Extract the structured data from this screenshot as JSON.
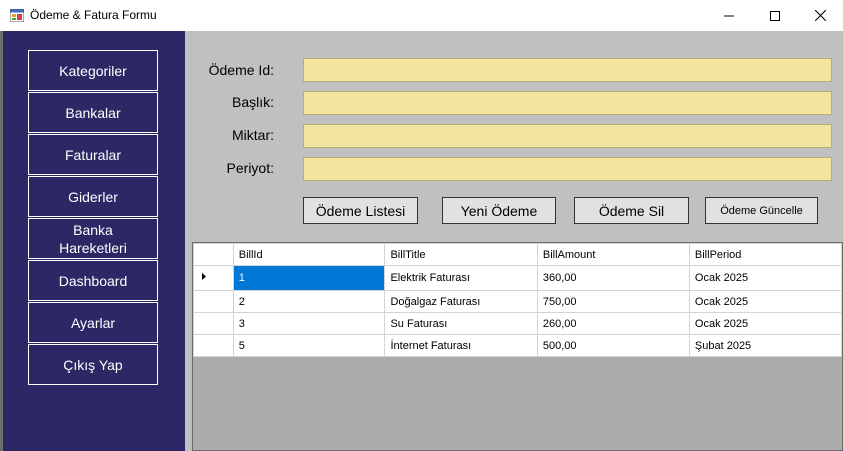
{
  "window": {
    "title": "Ödeme & Fatura Formu"
  },
  "sidebar": {
    "items": [
      {
        "label": "Kategoriler"
      },
      {
        "label": "Bankalar"
      },
      {
        "label": "Faturalar"
      },
      {
        "label": "Giderler"
      },
      {
        "label": "Banka Hareketleri"
      },
      {
        "label": "Dashboard"
      },
      {
        "label": "Ayarlar"
      },
      {
        "label": "Çıkış Yap"
      }
    ]
  },
  "form": {
    "id_label": "Ödeme Id:",
    "title_label": "Başlık:",
    "amount_label": "Miktar:",
    "period_label": "Periyot:",
    "id_value": "",
    "title_value": "",
    "amount_value": "",
    "period_value": ""
  },
  "actions": {
    "list": "Ödeme Listesi",
    "new": "Yeni Ödeme",
    "delete": "Ödeme Sil",
    "update": "Ödeme Güncelle"
  },
  "grid": {
    "columns": [
      "BillId",
      "BillTitle",
      "BillAmount",
      "BillPeriod"
    ],
    "rows": [
      [
        "1",
        "Elektrik Faturası",
        "360,00",
        "Ocak 2025"
      ],
      [
        "2",
        "Doğalgaz Faturası",
        "750,00",
        "Ocak 2025"
      ],
      [
        "3",
        "Su Faturası",
        "260,00",
        "Ocak 2025"
      ],
      [
        "5",
        "İnternet Faturası",
        "500,00",
        "Şubat 2025"
      ]
    ]
  },
  "colors": {
    "sidebar_bg": "#2c2765",
    "field_bg": "#f2e5a0",
    "selection": "#0078d7",
    "panel_bg": "#c0c0c0"
  }
}
